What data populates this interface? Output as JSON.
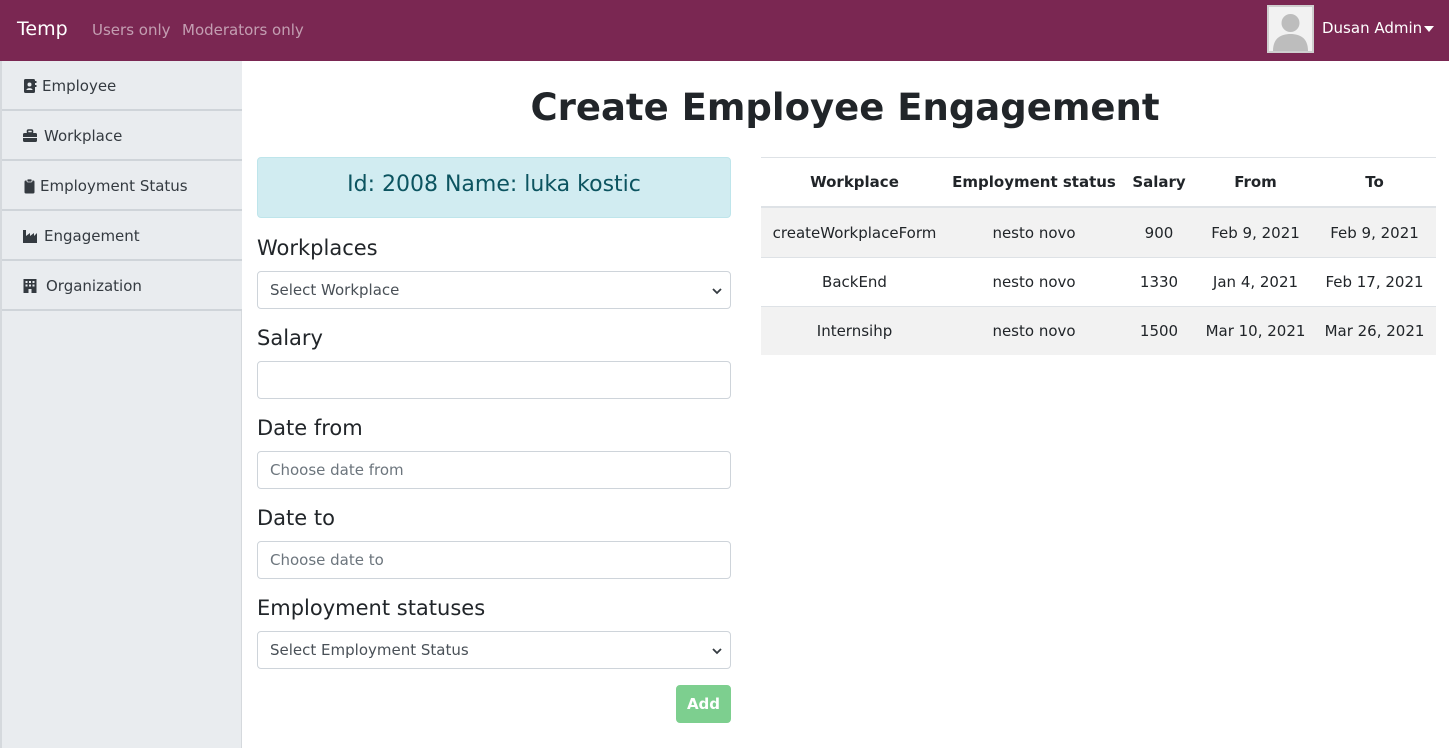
{
  "navbar": {
    "brand": "Temp",
    "links": [
      "Users only",
      "Moderators only"
    ],
    "user_name": "Dusan Admin",
    "bg_color": "#7a2752"
  },
  "sidebar": {
    "items": [
      {
        "label": "Employee",
        "icon": "id-card-icon"
      },
      {
        "label": "Workplace",
        "icon": "briefcase-icon"
      },
      {
        "label": "Employment Status",
        "icon": "clipboard-icon"
      },
      {
        "label": "Engagement",
        "icon": "industry-icon"
      },
      {
        "label": "Organization",
        "icon": "building-icon"
      }
    ]
  },
  "main": {
    "title": "Create Employee Engagement",
    "employee_info": "Id: 2008 Name: luka kostic",
    "form": {
      "workplaces_label": "Workplaces",
      "workplace_select": "Select Workplace",
      "salary_label": "Salary",
      "salary_value": "",
      "date_from_label": "Date from",
      "date_from_placeholder": "Choose date from",
      "date_to_label": "Date to",
      "date_to_placeholder": "Choose date to",
      "statuses_label": "Employment statuses",
      "status_select": "Select Employment Status",
      "add_button": "Add"
    },
    "table": {
      "headers": [
        "Workplace",
        "Employment status",
        "Salary",
        "From",
        "To"
      ],
      "rows": [
        [
          "createWorkplaceForm",
          "nesto novo",
          "900",
          "Feb 9, 2021",
          "Feb 9, 2021"
        ],
        [
          "BackEnd",
          "nesto novo",
          "1330",
          "Jan 4, 2021",
          "Feb 17, 2021"
        ],
        [
          "Internsihp",
          "nesto novo",
          "1500",
          "Mar 10, 2021",
          "Mar 26, 2021"
        ]
      ]
    }
  }
}
